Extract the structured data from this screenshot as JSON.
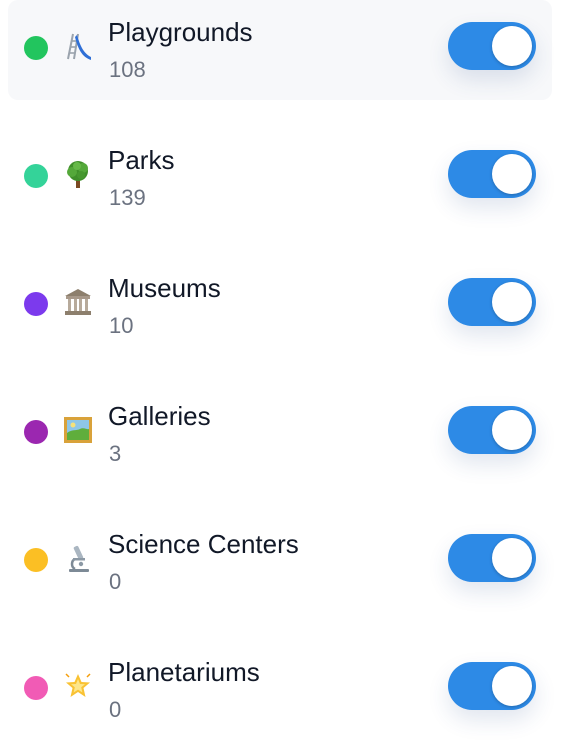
{
  "categories": [
    {
      "label": "Playgrounds",
      "count": "108",
      "color": "#22c55e",
      "icon": "slide-icon",
      "enabled": true,
      "highlighted": true
    },
    {
      "label": "Parks",
      "count": "139",
      "color": "#34d399",
      "icon": "tree-icon",
      "enabled": true,
      "highlighted": false
    },
    {
      "label": "Museums",
      "count": "10",
      "color": "#7c3aed",
      "icon": "classical-building-icon",
      "enabled": true,
      "highlighted": false
    },
    {
      "label": "Galleries",
      "count": "3",
      "color": "#9b27b0",
      "icon": "framed-picture-icon",
      "enabled": true,
      "highlighted": false
    },
    {
      "label": "Science Centers",
      "count": "0",
      "color": "#fbbf24",
      "icon": "microscope-icon",
      "enabled": true,
      "highlighted": false
    },
    {
      "label": "Planetariums",
      "count": "0",
      "color": "#f15bb5",
      "icon": "glowing-star-icon",
      "enabled": true,
      "highlighted": false
    }
  ]
}
